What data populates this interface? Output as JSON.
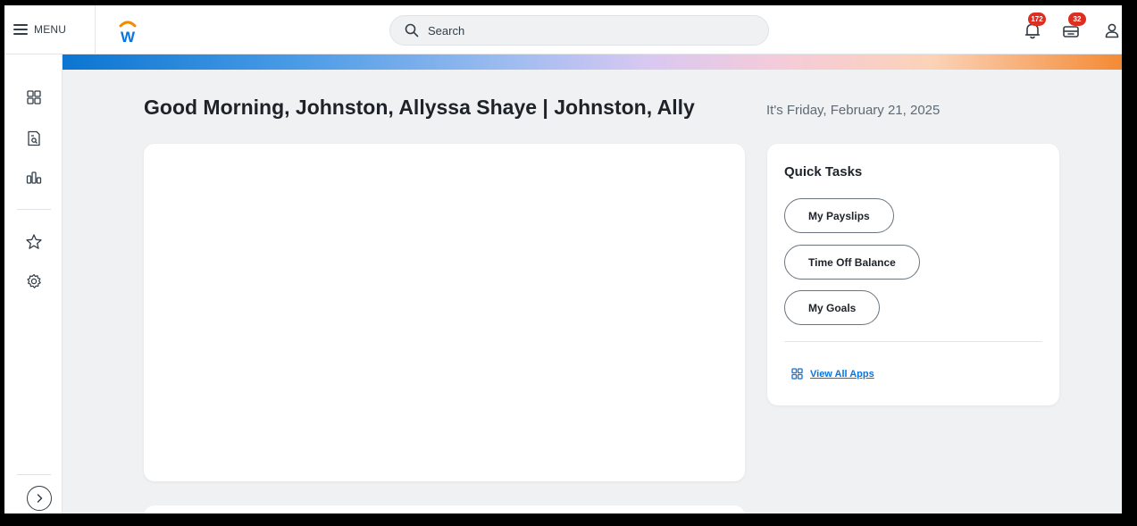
{
  "topbar": {
    "menu_label": "MENU",
    "logo_letter": "W",
    "search_placeholder": "Search",
    "notifications_count": "172",
    "inbox_count": "32"
  },
  "rail": {
    "items": [
      {
        "icon": "grid-apps-icon"
      },
      {
        "icon": "document-search-icon"
      },
      {
        "icon": "bar-chart-icon"
      },
      {
        "icon": "star-icon"
      },
      {
        "icon": "gear-icon"
      }
    ],
    "expand_icon": "chevron-right-icon"
  },
  "main": {
    "greeting": "Good Morning, Johnston, Allyssa Shaye | Johnston, Ally",
    "date": "It's Friday, February 21, 2025"
  },
  "quick_tasks": {
    "title": "Quick Tasks",
    "tasks": [
      {
        "label": "My Payslips"
      },
      {
        "label": "Time Off Balance"
      },
      {
        "label": "My Goals"
      }
    ],
    "view_all_label": "View All Apps"
  },
  "colors": {
    "accent_blue": "#0875e1",
    "badge_red": "#de2e21",
    "logo_orange": "#f38b00",
    "logo_blue": "#0875e1"
  }
}
